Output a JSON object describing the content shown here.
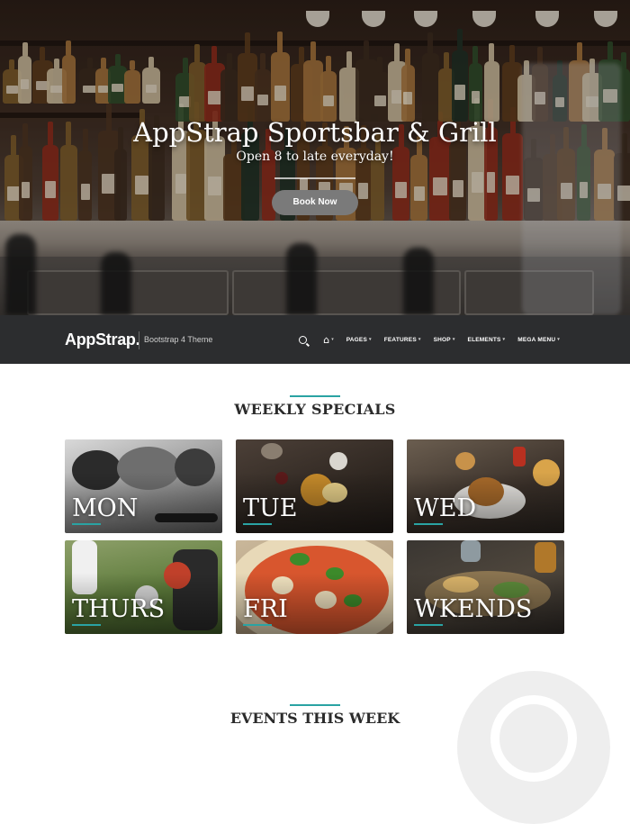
{
  "hero": {
    "title": "AppStrap Sportsbar & Grill",
    "subtitle": "Open 8 to late everyday!",
    "cta_label": "Book Now"
  },
  "navbar": {
    "brand": "AppStrap.",
    "tagline": "Bootstrap 4 Theme",
    "search_icon": "search-icon",
    "home_icon": "home-icon",
    "items": [
      {
        "label": "PAGES"
      },
      {
        "label": "FEATURES"
      },
      {
        "label": "SHOP"
      },
      {
        "label": "ELEMENTS"
      },
      {
        "label": "MEGA MENU"
      }
    ]
  },
  "specials": {
    "title": "WEEKLY SPECIALS",
    "days": [
      {
        "label": "MON"
      },
      {
        "label": "TUE"
      },
      {
        "label": "WED"
      },
      {
        "label": "THURS"
      },
      {
        "label": "FRI"
      },
      {
        "label": "WKENDS"
      }
    ]
  },
  "events": {
    "title": "EVENTS THIS WEEK"
  },
  "colors": {
    "accent": "#2aa3a3",
    "navbar_bg": "#2c2d2f",
    "button_bg": "#7a7a7a",
    "heading_text": "#2b2b2b"
  }
}
